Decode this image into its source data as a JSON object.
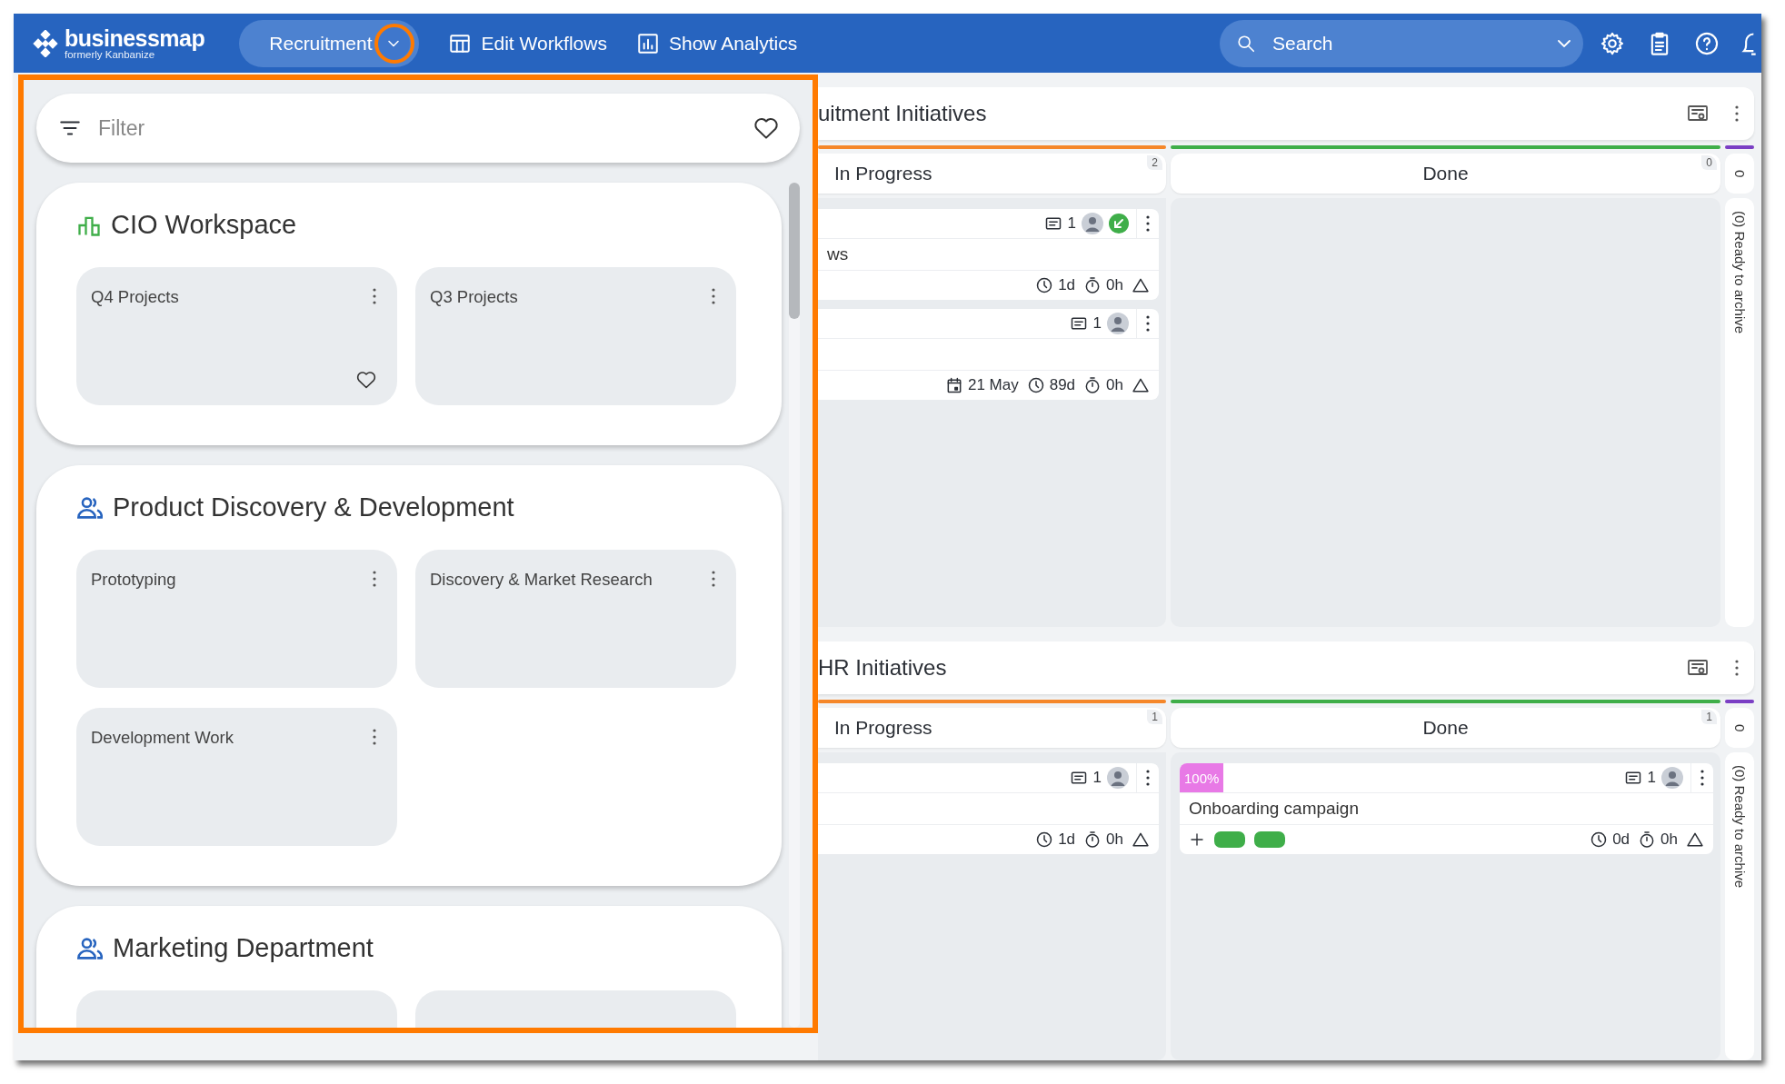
{
  "topbar": {
    "logo": {
      "name": "businessmap",
      "tagline": "formerly Kanbanize"
    },
    "workspace_button": {
      "label": "Recruitment",
      "highlighted": true
    },
    "nav": [
      {
        "label": "Edit Workflows",
        "kind": "table"
      },
      {
        "label": "Show Analytics",
        "kind": "chart"
      }
    ],
    "search": {
      "placeholder": "Search"
    }
  },
  "dropdown": {
    "highlighted": true,
    "filter": {
      "placeholder": "Filter"
    },
    "workspaces": [
      {
        "name": "CIO Workspace",
        "kind": "chart",
        "boards": [
          {
            "name": "Q4 Projects",
            "hovered": true
          },
          {
            "name": "Q3 Projects",
            "hovered": false
          }
        ]
      },
      {
        "name": "Product Discovery & Development",
        "kind": "people",
        "boards": [
          {
            "name": "Prototyping",
            "hovered": false
          },
          {
            "name": "Discovery & Market Research",
            "hovered": false
          },
          {
            "name": "Development Work",
            "hovered": false
          }
        ]
      },
      {
        "name": "Marketing Department",
        "kind": "people",
        "boards": [
          {
            "hovered": false
          },
          {
            "hovered": false
          }
        ]
      }
    ]
  },
  "boards": [
    {
      "title": "uitment Initiatives",
      "columns": [
        {
          "name": "In Progress",
          "count": "2",
          "color": "#f5872a",
          "cards": [
            {
              "comments": "1",
              "linked": true,
              "title": "ws",
              "age": "1d",
              "logged": "0h"
            },
            {
              "comments": "1",
              "linked": false,
              "due": "21 May",
              "age": "89d",
              "logged": "0h"
            }
          ]
        },
        {
          "name": "Done",
          "count": "0",
          "color": "#3fae49"
        }
      ],
      "archive": {
        "count": "0",
        "label": "(0) Ready to archive",
        "color": "#7b3fc4"
      }
    },
    {
      "title": "HR Initiatives",
      "columns": [
        {
          "name": "In Progress",
          "count": "1",
          "color": "#f5872a",
          "cards": [
            {
              "comments": "1",
              "linked": false,
              "age": "1d",
              "logged": "0h"
            }
          ]
        },
        {
          "name": "Done",
          "count": "1",
          "color": "#3fae49",
          "cards": [
            {
              "progress": "100%",
              "comments": "1",
              "linked": false,
              "title": "Onboarding campaign",
              "tags": [
                {
                  "color": "#3fae49"
                },
                {
                  "color": "#3fae49"
                }
              ],
              "age": "0d",
              "logged": "0h"
            }
          ]
        }
      ],
      "archive": {
        "count": "0",
        "label": "(0) Ready to archive",
        "color": "#7b3fc4"
      }
    }
  ]
}
